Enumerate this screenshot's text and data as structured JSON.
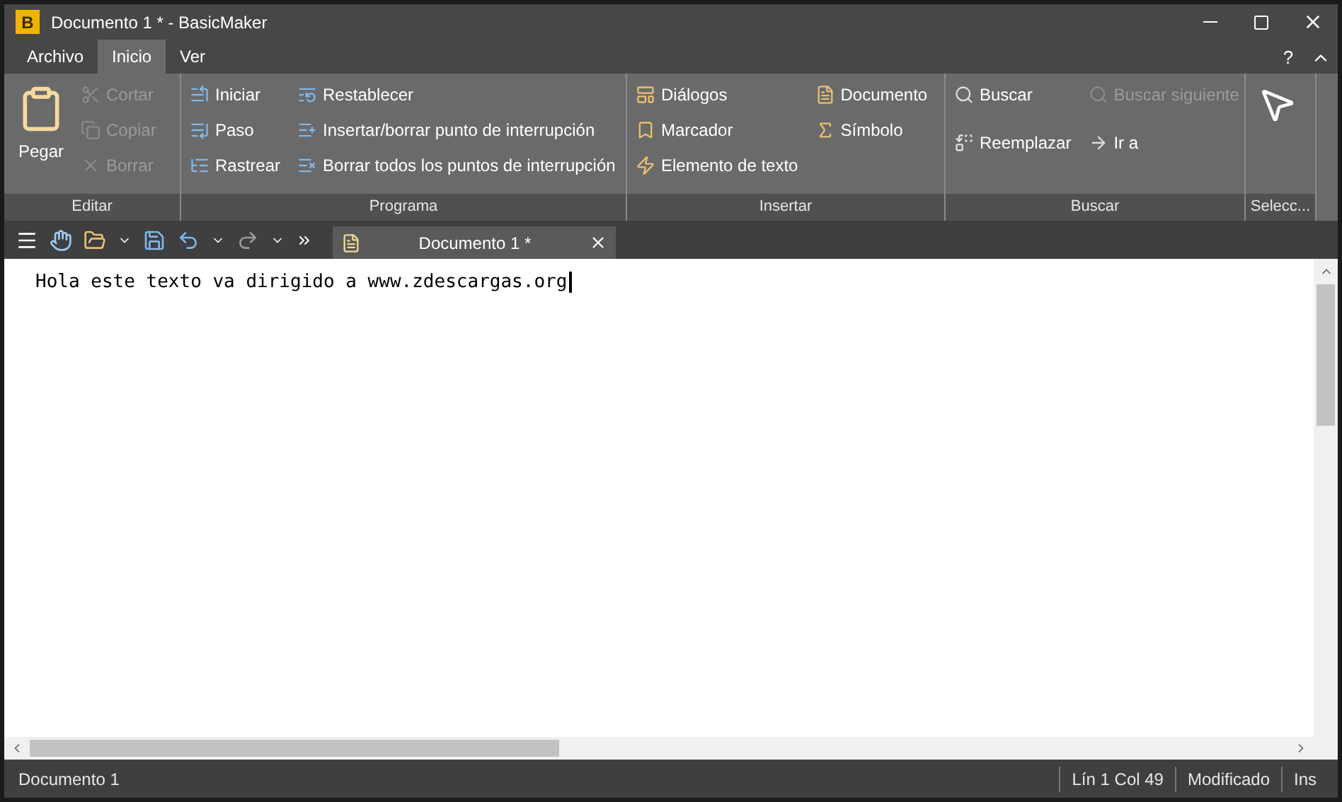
{
  "window": {
    "title": "Documento 1 * - BasicMaker",
    "app_icon_letter": "B",
    "help": "?"
  },
  "ribbon_tabs": [
    {
      "label": "Archivo",
      "selected": false
    },
    {
      "label": "Inicio",
      "selected": true
    },
    {
      "label": "Ver",
      "selected": false
    }
  ],
  "ribbon_groups": [
    {
      "label": "Editar",
      "large": {
        "label": "Pegar"
      },
      "columns": [
        [
          {
            "label": "Cortar",
            "disabled": true
          },
          {
            "label": "Copiar",
            "disabled": true
          },
          {
            "label": "Borrar",
            "disabled": true
          }
        ]
      ]
    },
    {
      "label": "Programa",
      "columns": [
        [
          {
            "label": "Iniciar",
            "disabled": false
          },
          {
            "label": "Paso",
            "disabled": false
          },
          {
            "label": "Rastrear",
            "disabled": false
          }
        ],
        [
          {
            "label": "Restablecer",
            "disabled": false
          },
          {
            "label": "Insertar/borrar punto de interrupción",
            "disabled": false
          },
          {
            "label": "Borrar todos los puntos de interrupción",
            "disabled": false
          }
        ]
      ]
    },
    {
      "label": "Insertar",
      "columns": [
        [
          {
            "label": "Diálogos",
            "disabled": false
          },
          {
            "label": "Marcador",
            "disabled": false
          },
          {
            "label": "Elemento de texto",
            "disabled": false
          }
        ],
        [
          {
            "label": "Documento",
            "disabled": false
          },
          {
            "label": "Símbolo",
            "disabled": false
          }
        ]
      ]
    },
    {
      "label": "Buscar",
      "columns": [
        [
          {
            "label": "Buscar",
            "disabled": false
          },
          {
            "label": "Reemplazar",
            "disabled": false
          }
        ],
        [
          {
            "label": "Buscar siguiente",
            "disabled": true
          },
          {
            "label": "Ir a",
            "disabled": false
          }
        ]
      ]
    },
    {
      "label": "Selecc..."
    }
  ],
  "document_tabs": [
    {
      "label": "Documento 1 *",
      "selected": true
    }
  ],
  "editor": {
    "text": "Hola este texto va dirigido a www.zdescargas.org"
  },
  "status_bar": [
    "Documento 1",
    "Lín 1 Col 49",
    "Modificado",
    "Ins"
  ]
}
